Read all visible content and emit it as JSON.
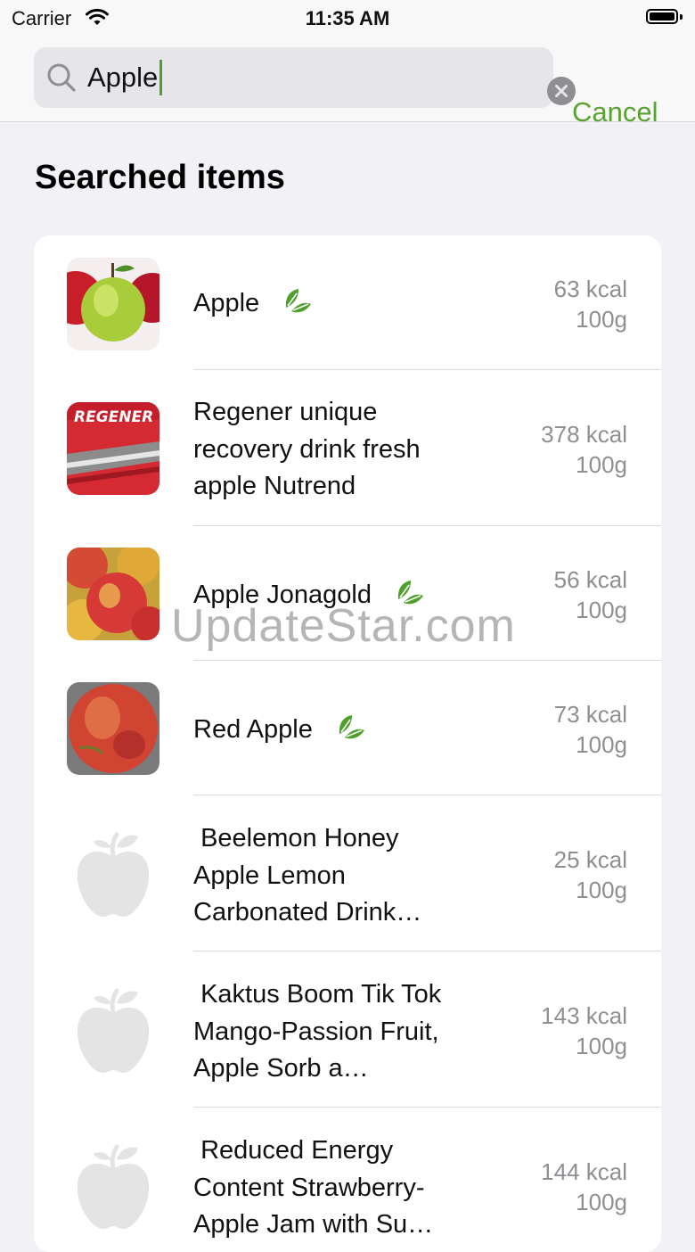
{
  "status_bar": {
    "carrier": "Carrier",
    "time": "11:35 AM"
  },
  "search": {
    "value": "Apple",
    "cancel_label": "Cancel"
  },
  "section_title": "Searched items",
  "items": [
    {
      "name": "Apple",
      "kcal": "63 kcal",
      "amount": "100g",
      "leaf": true,
      "thumb": "green-apple"
    },
    {
      "name": "Regener unique recovery drink fresh apple Nutrend",
      "kcal": "378 kcal",
      "amount": "100g",
      "leaf": false,
      "thumb": "regener-pack"
    },
    {
      "name": "Apple Jonagold",
      "kcal": "56 kcal",
      "amount": "100g",
      "leaf": true,
      "thumb": "jonagold-apples"
    },
    {
      "name": "Red Apple",
      "kcal": "73 kcal",
      "amount": "100g",
      "leaf": true,
      "thumb": "red-apple"
    },
    {
      "name": " Beelemon Honey Apple Lemon Carbonated Drink…",
      "kcal": "25 kcal",
      "amount": "100g",
      "leaf": false,
      "thumb": "apple-placeholder-icon"
    },
    {
      "name": " Kaktus Boom Tik Tok Mango-Passion Fruit, Apple Sorb a…",
      "kcal": "143 kcal",
      "amount": "100g",
      "leaf": false,
      "thumb": "apple-placeholder-icon"
    },
    {
      "name": " Reduced Energy Content Strawberry-Apple Jam with Su…",
      "kcal": "144 kcal",
      "amount": "100g",
      "leaf": false,
      "thumb": "apple-placeholder-icon"
    }
  ],
  "watermark": "UpdateStar.com",
  "colors": {
    "accent": "#5aa22f",
    "leaf": "#4f9f2b",
    "secondary_text": "#8e8e93"
  }
}
